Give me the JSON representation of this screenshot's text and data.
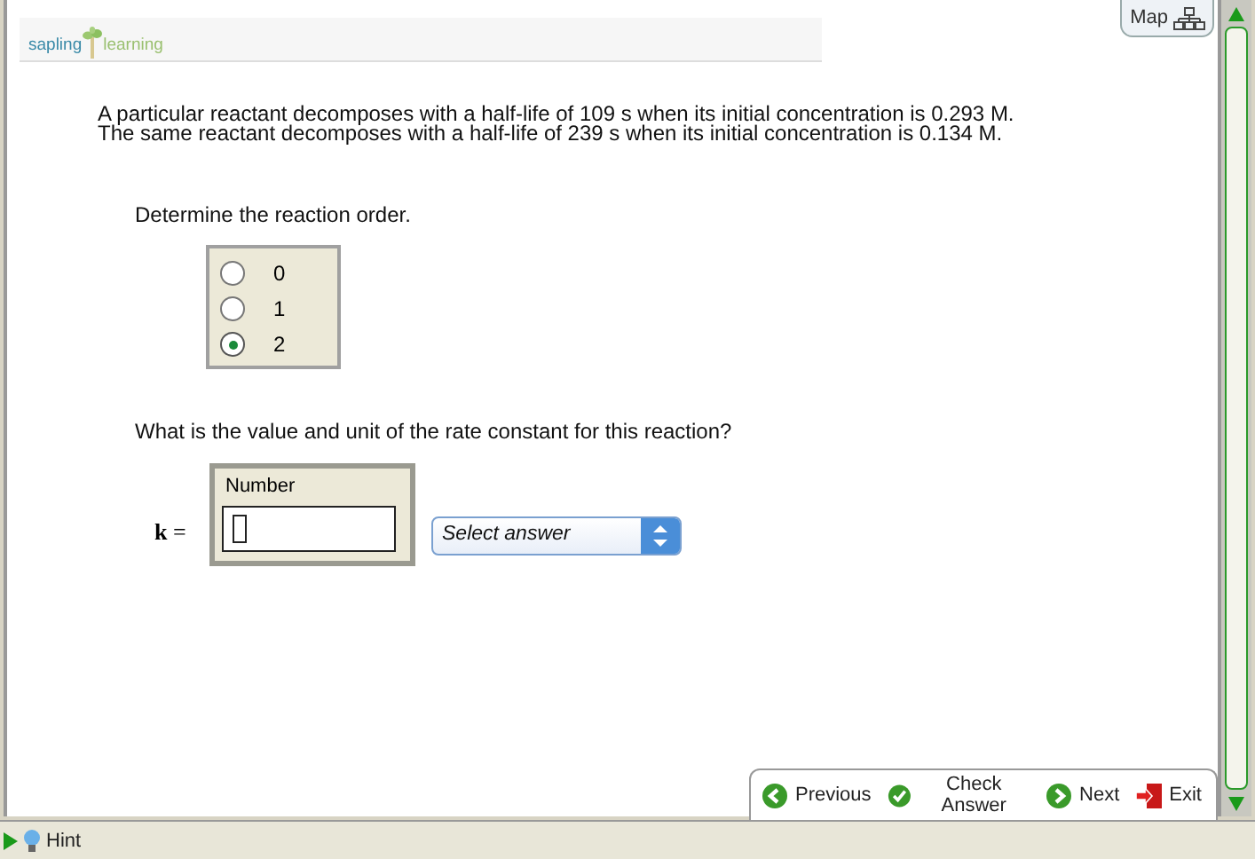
{
  "logo": {
    "word_1": "sapling",
    "word_2": "learning"
  },
  "map_button": {
    "label": "Map"
  },
  "problem": {
    "lines": [
      "A particular reactant decomposes with a half-life of 109 s when its initial concentration is 0.293 M.",
      "The same reactant decomposes with a half-life of 239 s when its initial concentration is 0.134 M."
    ]
  },
  "question_1": {
    "prompt": "Determine the reaction order.",
    "options": [
      {
        "label": "0",
        "selected": false
      },
      {
        "label": "1",
        "selected": false
      },
      {
        "label": "2",
        "selected": true
      }
    ]
  },
  "question_2": {
    "prompt": "What is the value and unit of the rate constant for this reaction?",
    "variable": "**k** =",
    "number_label": "Number",
    "unit_select": {
      "placeholder": "Select answer"
    }
  },
  "nav": [
    {
      "kind": "previous",
      "label": "Previous"
    },
    {
      "kind": "check",
      "label": "Check Answer"
    },
    {
      "kind": "next",
      "label": "Next"
    },
    {
      "kind": "exit",
      "label": "Exit"
    }
  ],
  "hint": {
    "label": "Hint"
  }
}
